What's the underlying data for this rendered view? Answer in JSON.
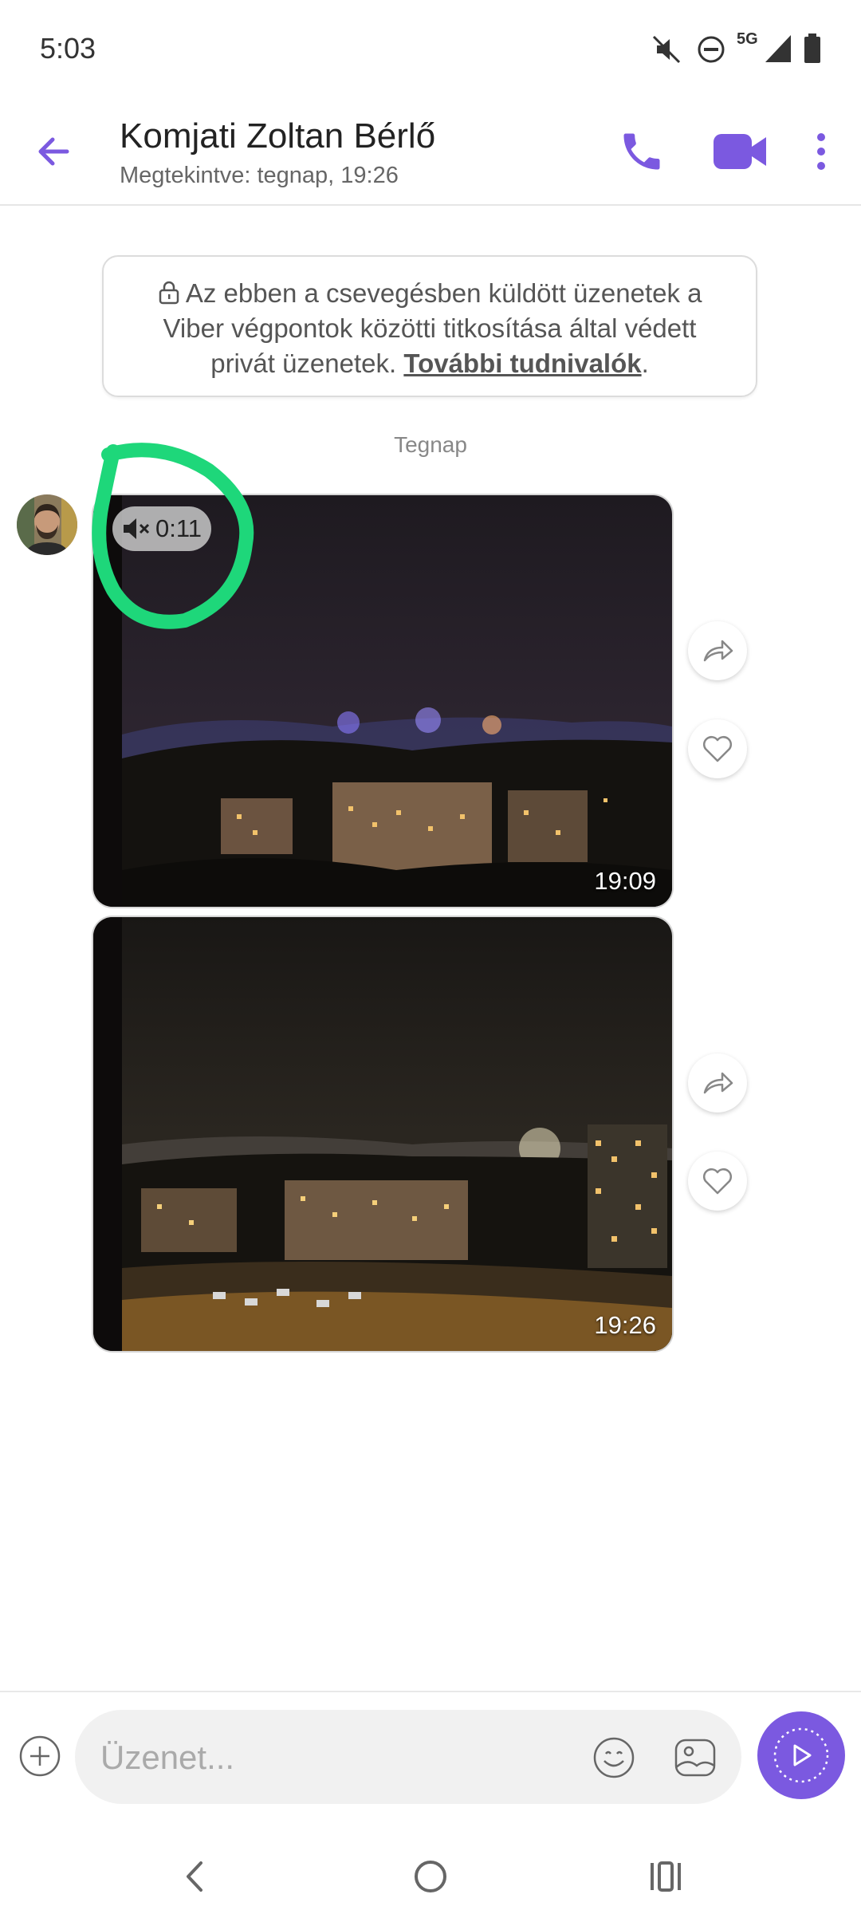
{
  "status_bar": {
    "time": "5:03",
    "network": "5G",
    "icons": [
      "mute-icon",
      "dnd-icon",
      "signal-icon",
      "battery-icon"
    ]
  },
  "header": {
    "contact_name": "Komjati Zoltan Bérlő",
    "last_seen": "Megtekintve: tegnap, 19:26",
    "icons": [
      "back-arrow-icon",
      "phone-icon",
      "video-call-icon",
      "more-vert-icon"
    ]
  },
  "encryption_notice": {
    "text": "Az ebben a csevegésben küldött üzenetek a Viber végpontok közötti titkosítása által védett privát üzenetek.",
    "link": "További tudnivalók",
    "suffix": "."
  },
  "date_separator": "Tegnap",
  "messages": [
    {
      "type": "video",
      "duration": "0:11",
      "muted": true,
      "time": "19:09"
    },
    {
      "type": "image",
      "time": "19:26"
    }
  ],
  "composer": {
    "placeholder": "Üzenet...",
    "icons": [
      "plus-icon",
      "emoji-icon",
      "gallery-icon",
      "send-icon"
    ]
  },
  "colors": {
    "accent": "#7b59e0",
    "annotation": "#1ed77a"
  }
}
